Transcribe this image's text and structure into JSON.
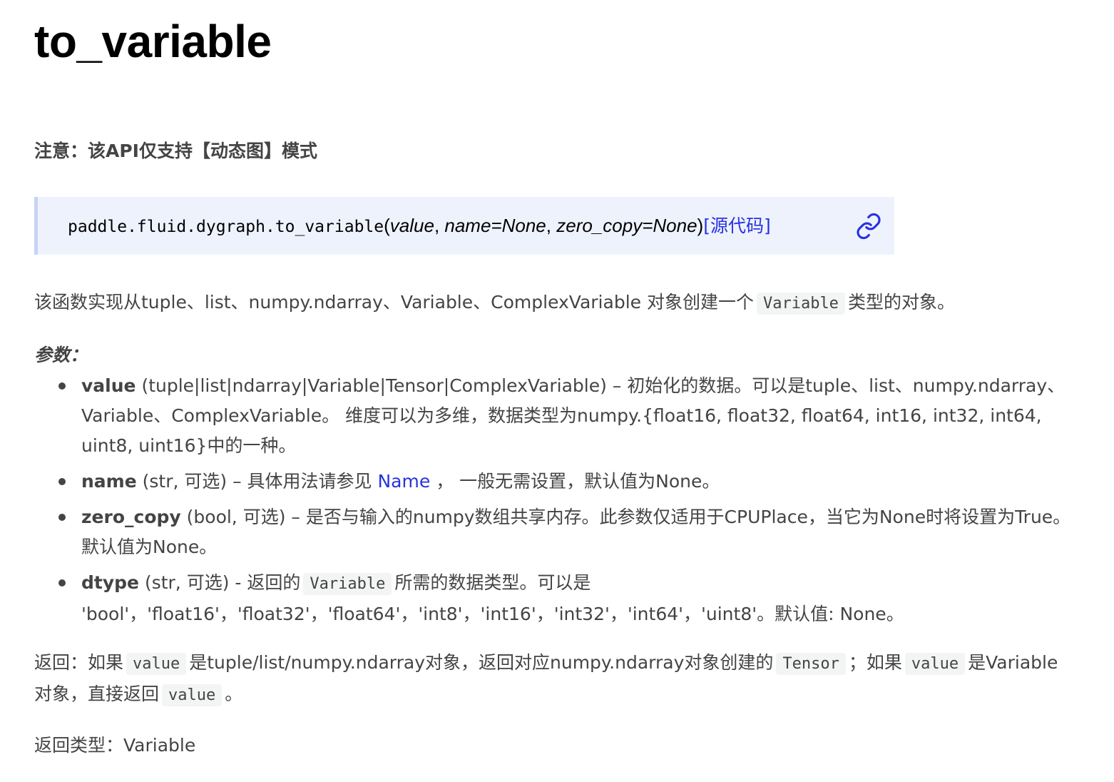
{
  "title": "to_variable",
  "notice": "注意：该API仅支持【动态图】模式",
  "signature": {
    "func": "paddle.fluid.dygraph.to_variable",
    "open": "(",
    "arg1": "value",
    "sep1": ", ",
    "arg2": "name=None",
    "sep2": ", ",
    "arg3": "zero_copy=None",
    "close": ")",
    "source_link": "[源代码]"
  },
  "description": {
    "before": "该函数实现从tuple、list、numpy.ndarray、Variable、ComplexVariable 对象创建一个",
    "code": "Variable",
    "after": "类型的对象。"
  },
  "params_label": "参数：",
  "params": [
    {
      "name": "value",
      "text": " (tuple|list|ndarray|Variable|Tensor|ComplexVariable) – 初始化的数据。可以是tuple、list、numpy.ndarray、Variable、ComplexVariable。 维度可以为多维，数据类型为numpy.{float16, float32, float64, int16, int32, int64, uint8, uint16}中的一种。"
    },
    {
      "name": "name",
      "text_before": " (str, 可选) – 具体用法请参见 ",
      "link": "Name",
      "text_after": " ， 一般无需设置，默认值为None。"
    },
    {
      "name": "zero_copy",
      "text": " (bool, 可选) – 是否与输入的numpy数组共享内存。此参数仅适用于CPUPlace，当它为None时将设置为True。默认值为None。"
    },
    {
      "name": "dtype",
      "text_before": " (str, 可选) - 返回的",
      "code": "Variable",
      "text_after": "所需的数据类型。可以是 'bool'，'float16'，'float32'，'float64'，'int8'，'int16'，'int32'，'int64'，'uint8'。默认值: None。"
    }
  ],
  "returns": {
    "p1": "返回：如果",
    "c1": "value",
    "p2": "是tuple/list/numpy.ndarray对象，返回对应numpy.ndarray对象创建的",
    "c2": "Tensor",
    "p3": "；如果",
    "c3": "value",
    "p4": "是Variable对象，直接返回",
    "c4": "value",
    "p5": "。"
  },
  "return_type": "返回类型：Variable",
  "icons": {
    "link": "link-icon"
  },
  "colors": {
    "link": "#2932e1",
    "signature_bg": "#eef2fd",
    "signature_border": "#c8d3f5",
    "code_bg": "#f3f4f4"
  }
}
